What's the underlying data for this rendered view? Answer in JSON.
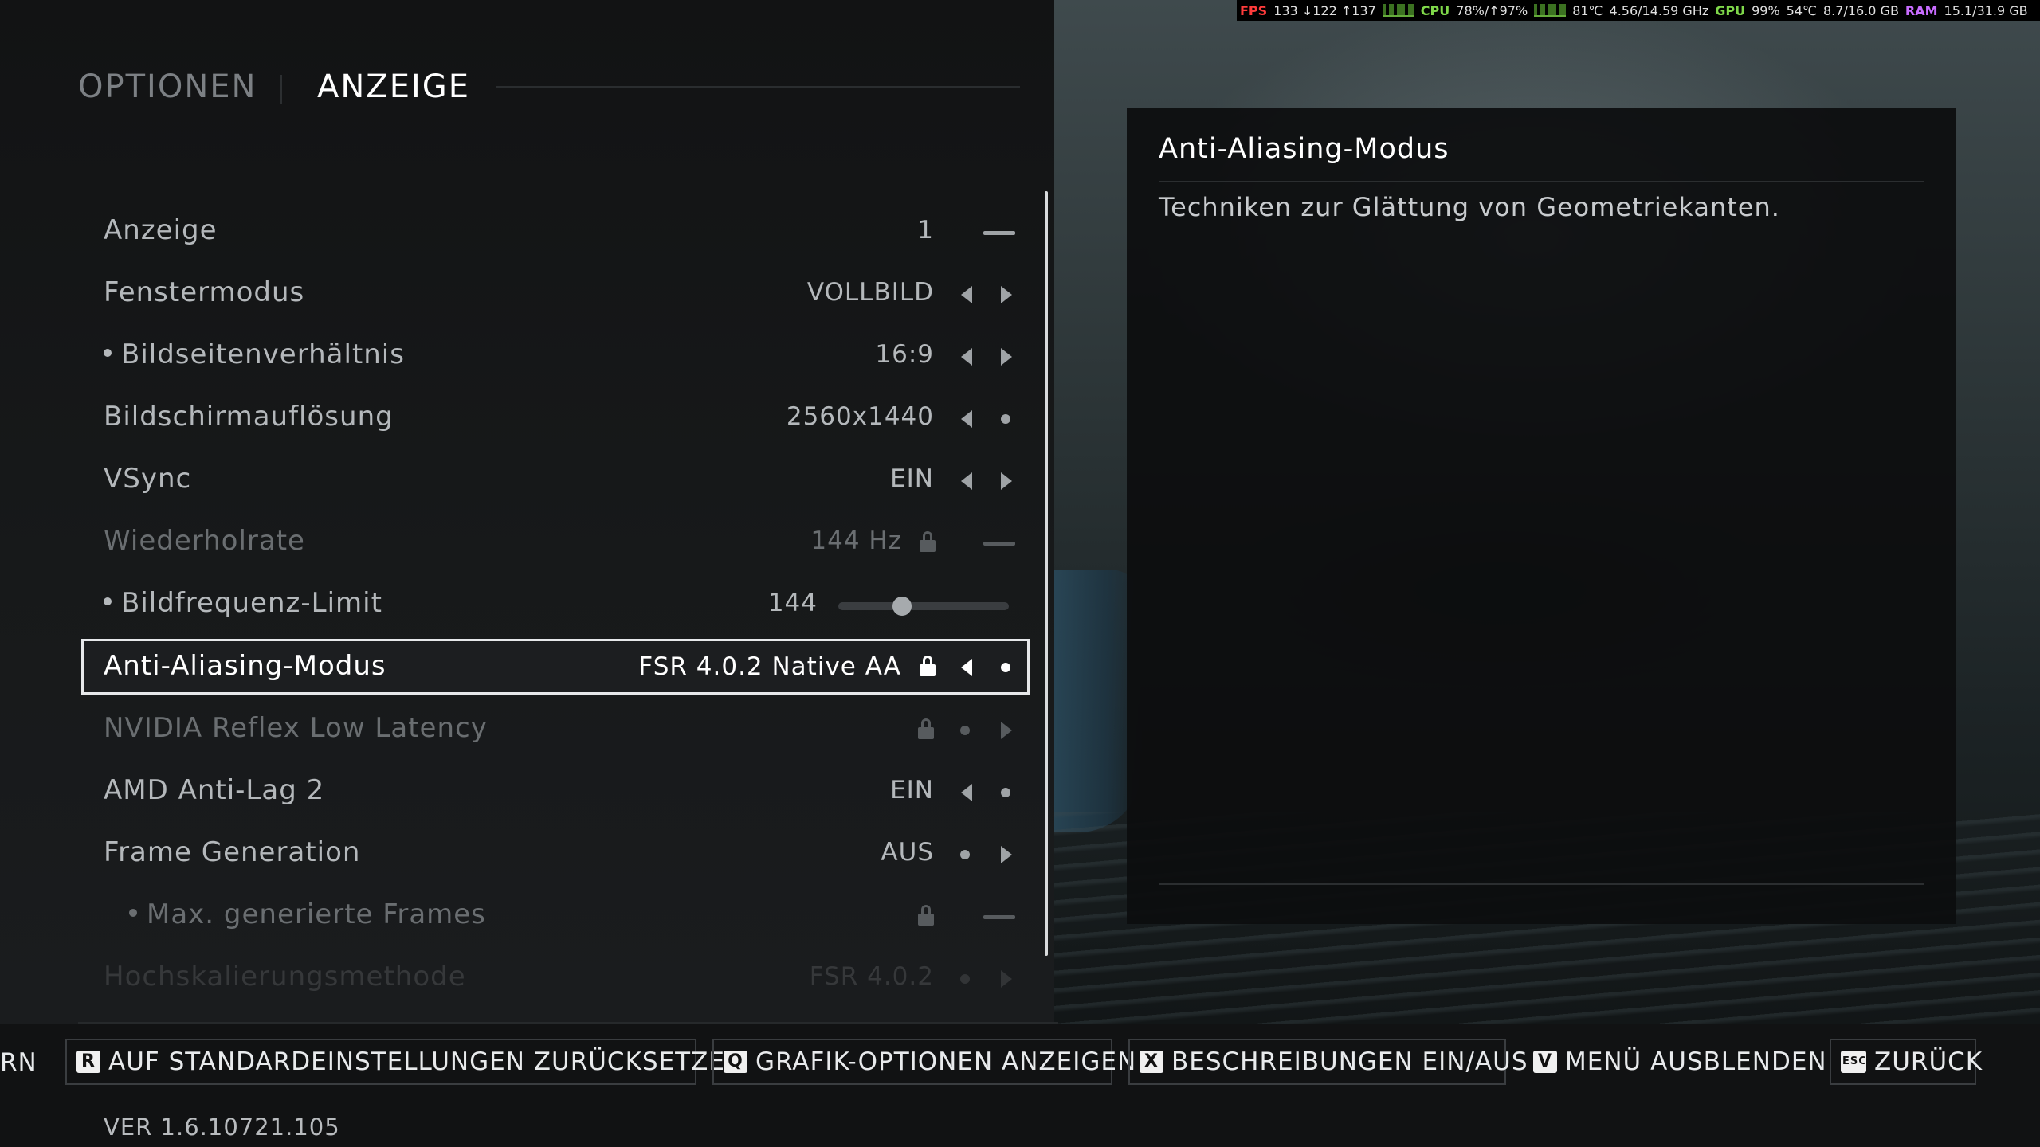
{
  "header": {
    "tab_options": "OPTIONEN",
    "tab_display": "ANZEIGE"
  },
  "settings": [
    {
      "label": "Anzeige",
      "value": "1",
      "control": "dash"
    },
    {
      "label": "Fenstermodus",
      "value": "VOLLBILD",
      "control": "arrows"
    },
    {
      "label": "Bildseitenverhältnis",
      "value": "16:9",
      "control": "arrows"
    },
    {
      "label": "Bildschirmauflösung",
      "value": "2560x1440",
      "control": "left-dot"
    },
    {
      "label": "VSync",
      "value": "EIN",
      "control": "arrows"
    },
    {
      "label": "Wiederholrate",
      "value": "144 Hz",
      "control": "lock-dash",
      "disabled": true
    },
    {
      "label": "Bildfrequenz-Limit",
      "value": "144",
      "control": "slider",
      "slider_fraction": 0.36
    },
    {
      "label": "Anti-Aliasing-Modus",
      "value": "FSR 4.0.2 Native AA",
      "control": "lock-left-dot",
      "selected": true
    },
    {
      "label": "NVIDIA Reflex Low Latency",
      "value": "",
      "control": "lock-dot-right",
      "disabled": true
    },
    {
      "label": "AMD Anti-Lag 2",
      "value": "EIN",
      "control": "left-dot"
    },
    {
      "label": "Frame Generation",
      "value": "AUS",
      "control": "dot-right"
    },
    {
      "label": "Max. generierte Frames",
      "value": "",
      "control": "lock-dash",
      "disabled": true
    },
    {
      "label": "Hochskalierungsmethode",
      "value": "FSR 4.0.2",
      "control": "dot-right",
      "faded": true
    }
  ],
  "detail": {
    "title": "Anti-Aliasing-Modus",
    "description": "Techniken zur Glättung von Geometriekanten."
  },
  "footer": {
    "cut_label": "RN",
    "buttons": [
      {
        "key": "R",
        "label": "AUF STANDARDEINSTELLUNGEN ZURÜCKSETZEN"
      },
      {
        "key": "Q",
        "label": "GRAFIK-OPTIONEN ANZEIGEN"
      },
      {
        "key": "X",
        "label": "BESCHREIBUNGEN EIN/AUS"
      },
      {
        "key": "V",
        "label": "MENÜ AUSBLENDEN"
      },
      {
        "key": "ESC",
        "label": "ZURÜCK"
      }
    ],
    "version": "VER 1.6.10721.105"
  },
  "overlay": {
    "fps_label": "FPS",
    "fps_value": "133 ↓122 ↑137",
    "cpu_label": "CPU",
    "cpu_value": "78%/↑97%",
    "cpu_temp": "81℃",
    "cpu_clock": "4.56/14.59 GHz",
    "gpu_label": "GPU",
    "gpu_value": "99%",
    "gpu_temp": "54℃",
    "gpu_mem": "8.7/16.0 GB",
    "ram_label": "RAM",
    "ram_value": "15.1/31.9 GB"
  },
  "colors": {
    "selected_border": "#e6e8ea",
    "overlay_red": "#ff3b3b",
    "overlay_green": "#7fd84a",
    "overlay_purple": "#c86cff"
  }
}
